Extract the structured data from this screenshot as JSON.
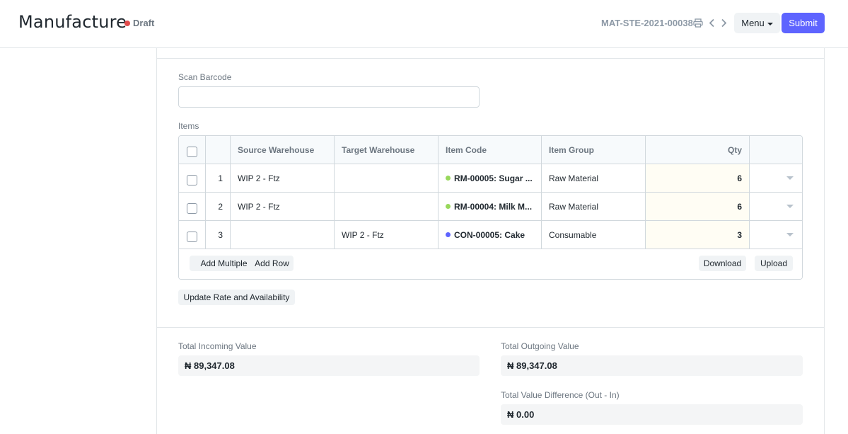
{
  "header": {
    "title": "Manufacture",
    "status": "Draft",
    "status_color": "#e24c4c",
    "doc_id": "MAT-STE-2021-00038",
    "menu_label": "Menu",
    "submit_label": "Submit",
    "accent_color": "#5e64ff"
  },
  "form": {
    "scan_barcode_label": "Scan Barcode",
    "scan_barcode_value": "",
    "items_label": "Items",
    "update_rate_label": "Update Rate and Availability"
  },
  "items_table": {
    "columns": [
      "Source Warehouse",
      "Target Warehouse",
      "Item Code",
      "Item Group",
      "Qty"
    ],
    "rows": [
      {
        "idx": "1",
        "source_warehouse": "WIP 2 - Ftz",
        "target_warehouse": "",
        "item_code": "RM-00005: Sugar ...",
        "item_dot_color": "#98d85b",
        "item_group": "Raw Material",
        "qty": "6"
      },
      {
        "idx": "2",
        "source_warehouse": "WIP 2 - Ftz",
        "target_warehouse": "",
        "item_code": "RM-00004: Milk M...",
        "item_dot_color": "#98d85b",
        "item_group": "Raw Material",
        "qty": "6"
      },
      {
        "idx": "3",
        "source_warehouse": "",
        "target_warehouse": "WIP 2 - Ftz",
        "item_code": "CON-00005: Cake",
        "item_dot_color": "#5e64ff",
        "item_group": "Consumable",
        "qty": "3"
      }
    ],
    "actions": {
      "add_multiple": "Add Multiple",
      "add_row": "Add Row",
      "download": "Download",
      "upload": "Upload"
    }
  },
  "totals": {
    "incoming_label": "Total Incoming Value",
    "incoming_value": "₦ 89,347.08",
    "outgoing_label": "Total Outgoing Value",
    "outgoing_value": "₦ 89,347.08",
    "difference_label": "Total Value Difference (Out - In)",
    "difference_value": "₦ 0.00"
  },
  "icons": {
    "print": "printer-icon",
    "prev": "chevron-left-icon",
    "next": "chevron-right-icon",
    "menu_caret": "caret-down-icon",
    "row_menu": "caret-down-icon"
  }
}
